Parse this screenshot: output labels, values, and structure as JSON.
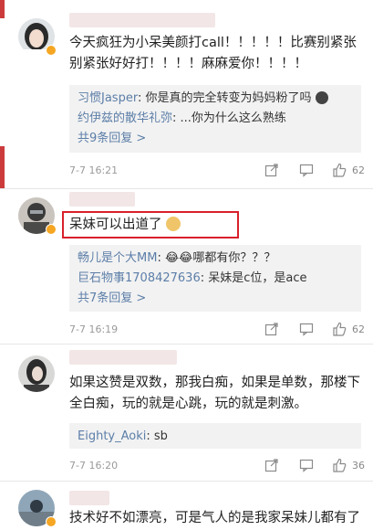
{
  "comments": [
    {
      "text": "今天疯狂为小呆美颜打call！！！！！比赛别紧张别紧张好好打！！！！麻麻爱你！！！！",
      "replies": [
        {
          "user": "习惯Jasper",
          "text": ": 你是真的完全转变为妈妈粉了吗"
        },
        {
          "user": "约伊兹的散华礼弥",
          "text": ": ...你为什么这么熟练"
        }
      ],
      "more": "共9条回复 >",
      "time": "7-7 16:21",
      "likes": "62"
    },
    {
      "text": "呆妹可以出道了",
      "replies": [
        {
          "user": "畅儿是个大MM",
          "text": ": 😂😂哪都有你？？？"
        },
        {
          "user": "巨石物事1708427636",
          "text": ": 呆妹是c位，是ace"
        }
      ],
      "more": "共7条回复 >",
      "time": "7-7 16:19",
      "likes": "62"
    },
    {
      "text": "如果这赞是双数，那我白痴，如果是单数，那楼下全白痴，玩的就是心跳，玩的就是刺激。",
      "replies": [
        {
          "user": "Eighty_Aoki",
          "text": ": sb"
        }
      ],
      "more": "",
      "time": "7-7 16:20",
      "likes": "36"
    },
    {
      "text": "技术好不如漂亮，可是气人的是我家呆妹儿都有了",
      "replies": [],
      "more": "",
      "time": "",
      "likes": ""
    }
  ],
  "icons": {
    "share": "share-icon",
    "comment": "comment-icon",
    "like": "thumbs-up-icon"
  },
  "colors": {
    "link": "#5c7ea8",
    "highlight_box": "#d8202a",
    "verified_badge": "#f5a623"
  }
}
